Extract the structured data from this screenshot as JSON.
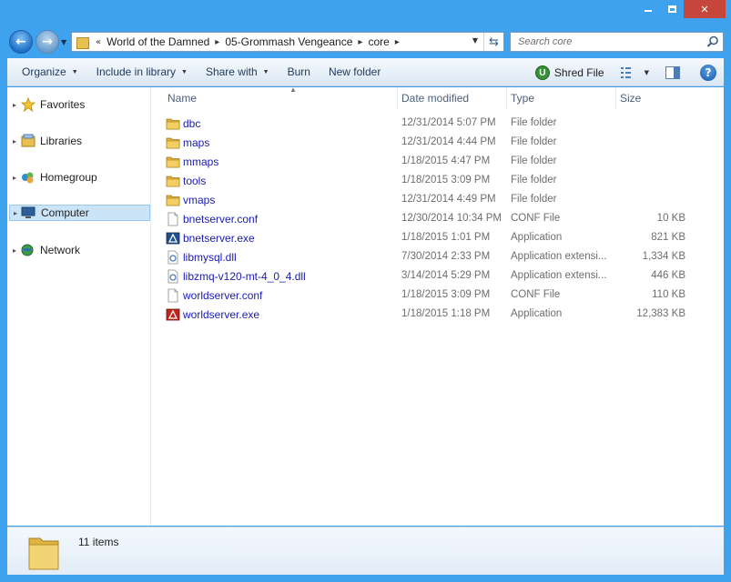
{
  "window": {
    "title_buttons": {
      "minimize": "minimize",
      "maximize": "maximize",
      "close": "✕"
    }
  },
  "address": {
    "overflow": "«",
    "crumbs": [
      "World of the Damned",
      "05-Grommash Vengeance",
      "core"
    ]
  },
  "search": {
    "placeholder": "Search core"
  },
  "toolbar": {
    "organize": "Organize",
    "include_in_library": "Include in library",
    "share_with": "Share with",
    "burn": "Burn",
    "new_folder": "New folder",
    "shred_file": "Shred File"
  },
  "navpane": {
    "items": [
      {
        "label": "Favorites",
        "icon": "star-icon"
      },
      {
        "label": "Libraries",
        "icon": "libraries-icon"
      },
      {
        "label": "Homegroup",
        "icon": "homegroup-icon"
      },
      {
        "label": "Computer",
        "icon": "computer-icon",
        "selected": true
      },
      {
        "label": "Network",
        "icon": "network-icon"
      }
    ]
  },
  "columns": {
    "name": "Name",
    "date": "Date modified",
    "type": "Type",
    "size": "Size"
  },
  "files": [
    {
      "name": "dbc",
      "date": "12/31/2014 5:07 PM",
      "type": "File folder",
      "size": "",
      "icon": "folder-icon"
    },
    {
      "name": "maps",
      "date": "12/31/2014 4:44 PM",
      "type": "File folder",
      "size": "",
      "icon": "folder-icon"
    },
    {
      "name": "mmaps",
      "date": "1/18/2015 4:47 PM",
      "type": "File folder",
      "size": "",
      "icon": "folder-icon"
    },
    {
      "name": "tools",
      "date": "1/18/2015 3:09 PM",
      "type": "File folder",
      "size": "",
      "icon": "folder-icon"
    },
    {
      "name": "vmaps",
      "date": "12/31/2014 4:49 PM",
      "type": "File folder",
      "size": "",
      "icon": "folder-icon"
    },
    {
      "name": "bnetserver.conf",
      "date": "12/30/2014 10:34 PM",
      "type": "CONF File",
      "size": "10 KB",
      "icon": "file-icon"
    },
    {
      "name": "bnetserver.exe",
      "date": "1/18/2015 1:01 PM",
      "type": "Application",
      "size": "821 KB",
      "icon": "exe-icon"
    },
    {
      "name": "libmysql.dll",
      "date": "7/30/2014 2:33 PM",
      "type": "Application extensi...",
      "size": "1,334 KB",
      "icon": "dll-icon"
    },
    {
      "name": "libzmq-v120-mt-4_0_4.dll",
      "date": "3/14/2014 5:29 PM",
      "type": "Application extensi...",
      "size": "446 KB",
      "icon": "dll-icon"
    },
    {
      "name": "worldserver.conf",
      "date": "1/18/2015 3:09 PM",
      "type": "CONF File",
      "size": "110 KB",
      "icon": "file-icon"
    },
    {
      "name": "worldserver.exe",
      "date": "1/18/2015 1:18 PM",
      "type": "Application",
      "size": "12,383 KB",
      "icon": "exe-red-icon"
    }
  ],
  "details": {
    "count": "11 items"
  }
}
